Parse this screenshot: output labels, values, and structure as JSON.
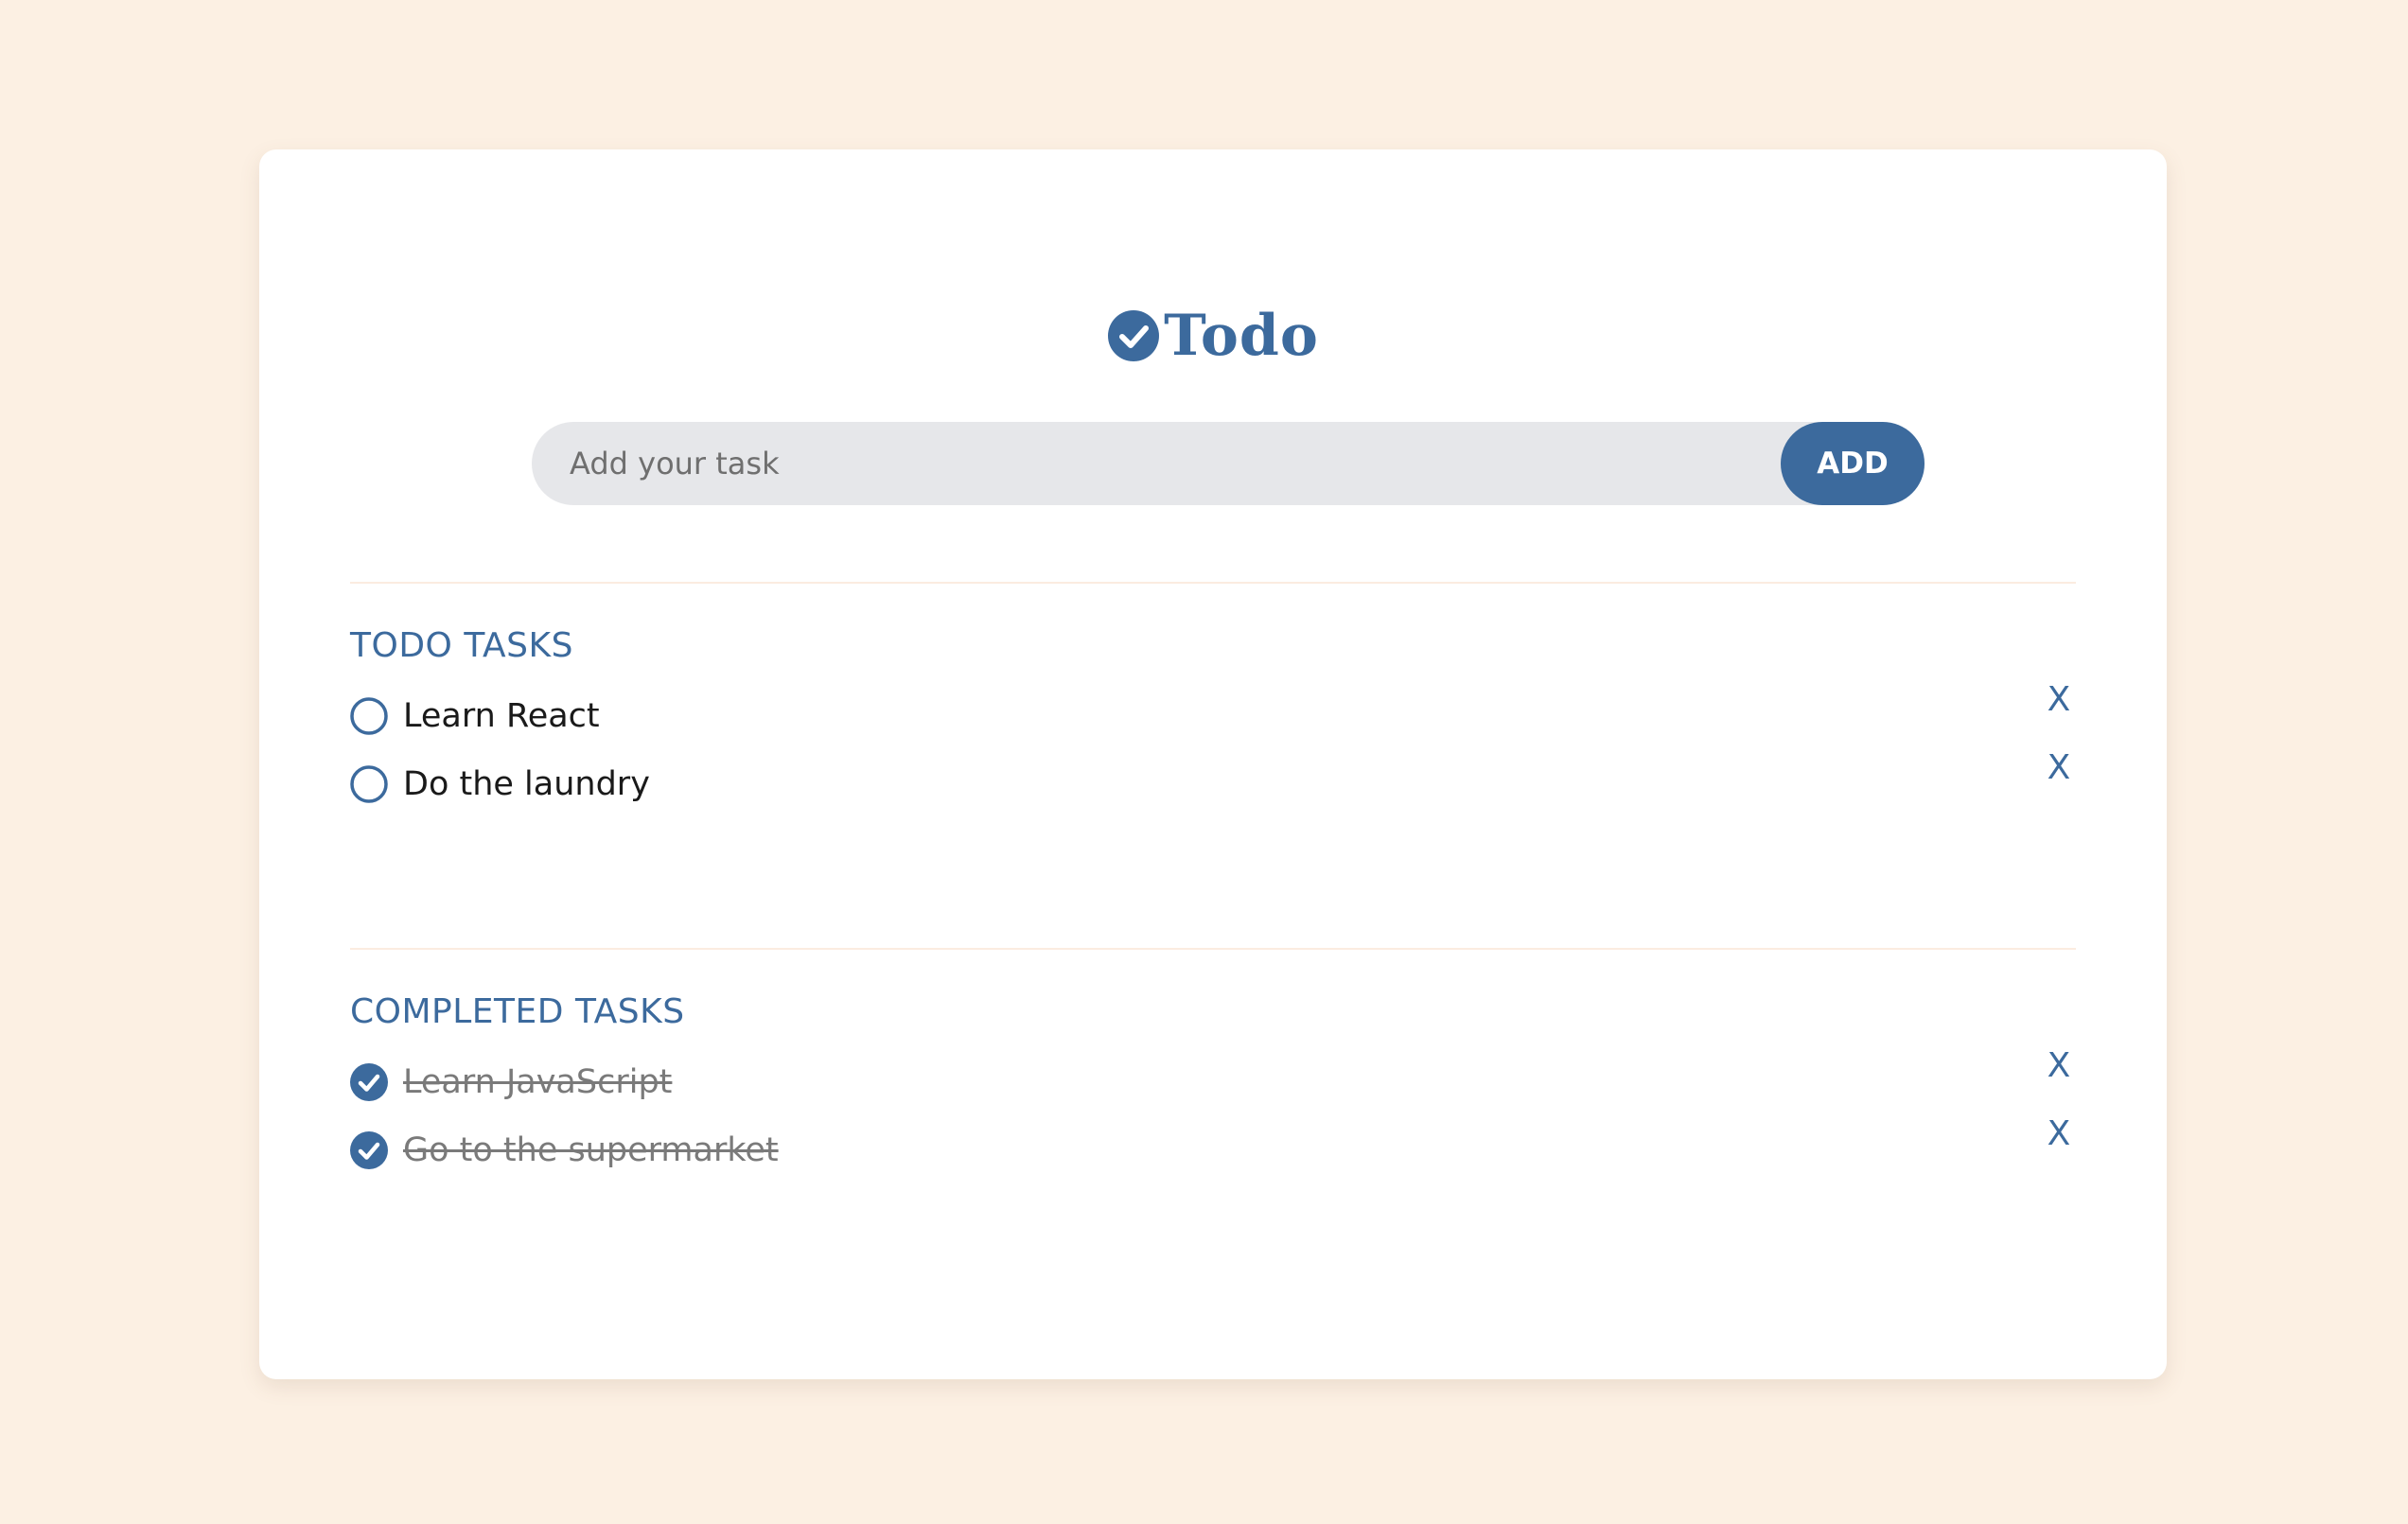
{
  "app": {
    "title": "Todo",
    "accent_color": "#3c6a9d",
    "background_color": "#fcf0e3"
  },
  "add_task": {
    "placeholder": "Add your task",
    "value": "",
    "button_label": "ADD"
  },
  "todo_section": {
    "heading": "TODO TASKS",
    "tasks": [
      {
        "text": "Learn React",
        "completed": false,
        "icon": "circle-outline-icon"
      },
      {
        "text": "Do the laundry",
        "completed": false,
        "icon": "circle-outline-icon"
      }
    ]
  },
  "completed_section": {
    "heading": "COMPLETED TASKS",
    "tasks": [
      {
        "text": "Learn JavaScript",
        "completed": true,
        "icon": "check-circle-icon"
      },
      {
        "text": "Go to the supermarket",
        "completed": true,
        "icon": "check-circle-icon"
      }
    ]
  },
  "delete_label": "X"
}
